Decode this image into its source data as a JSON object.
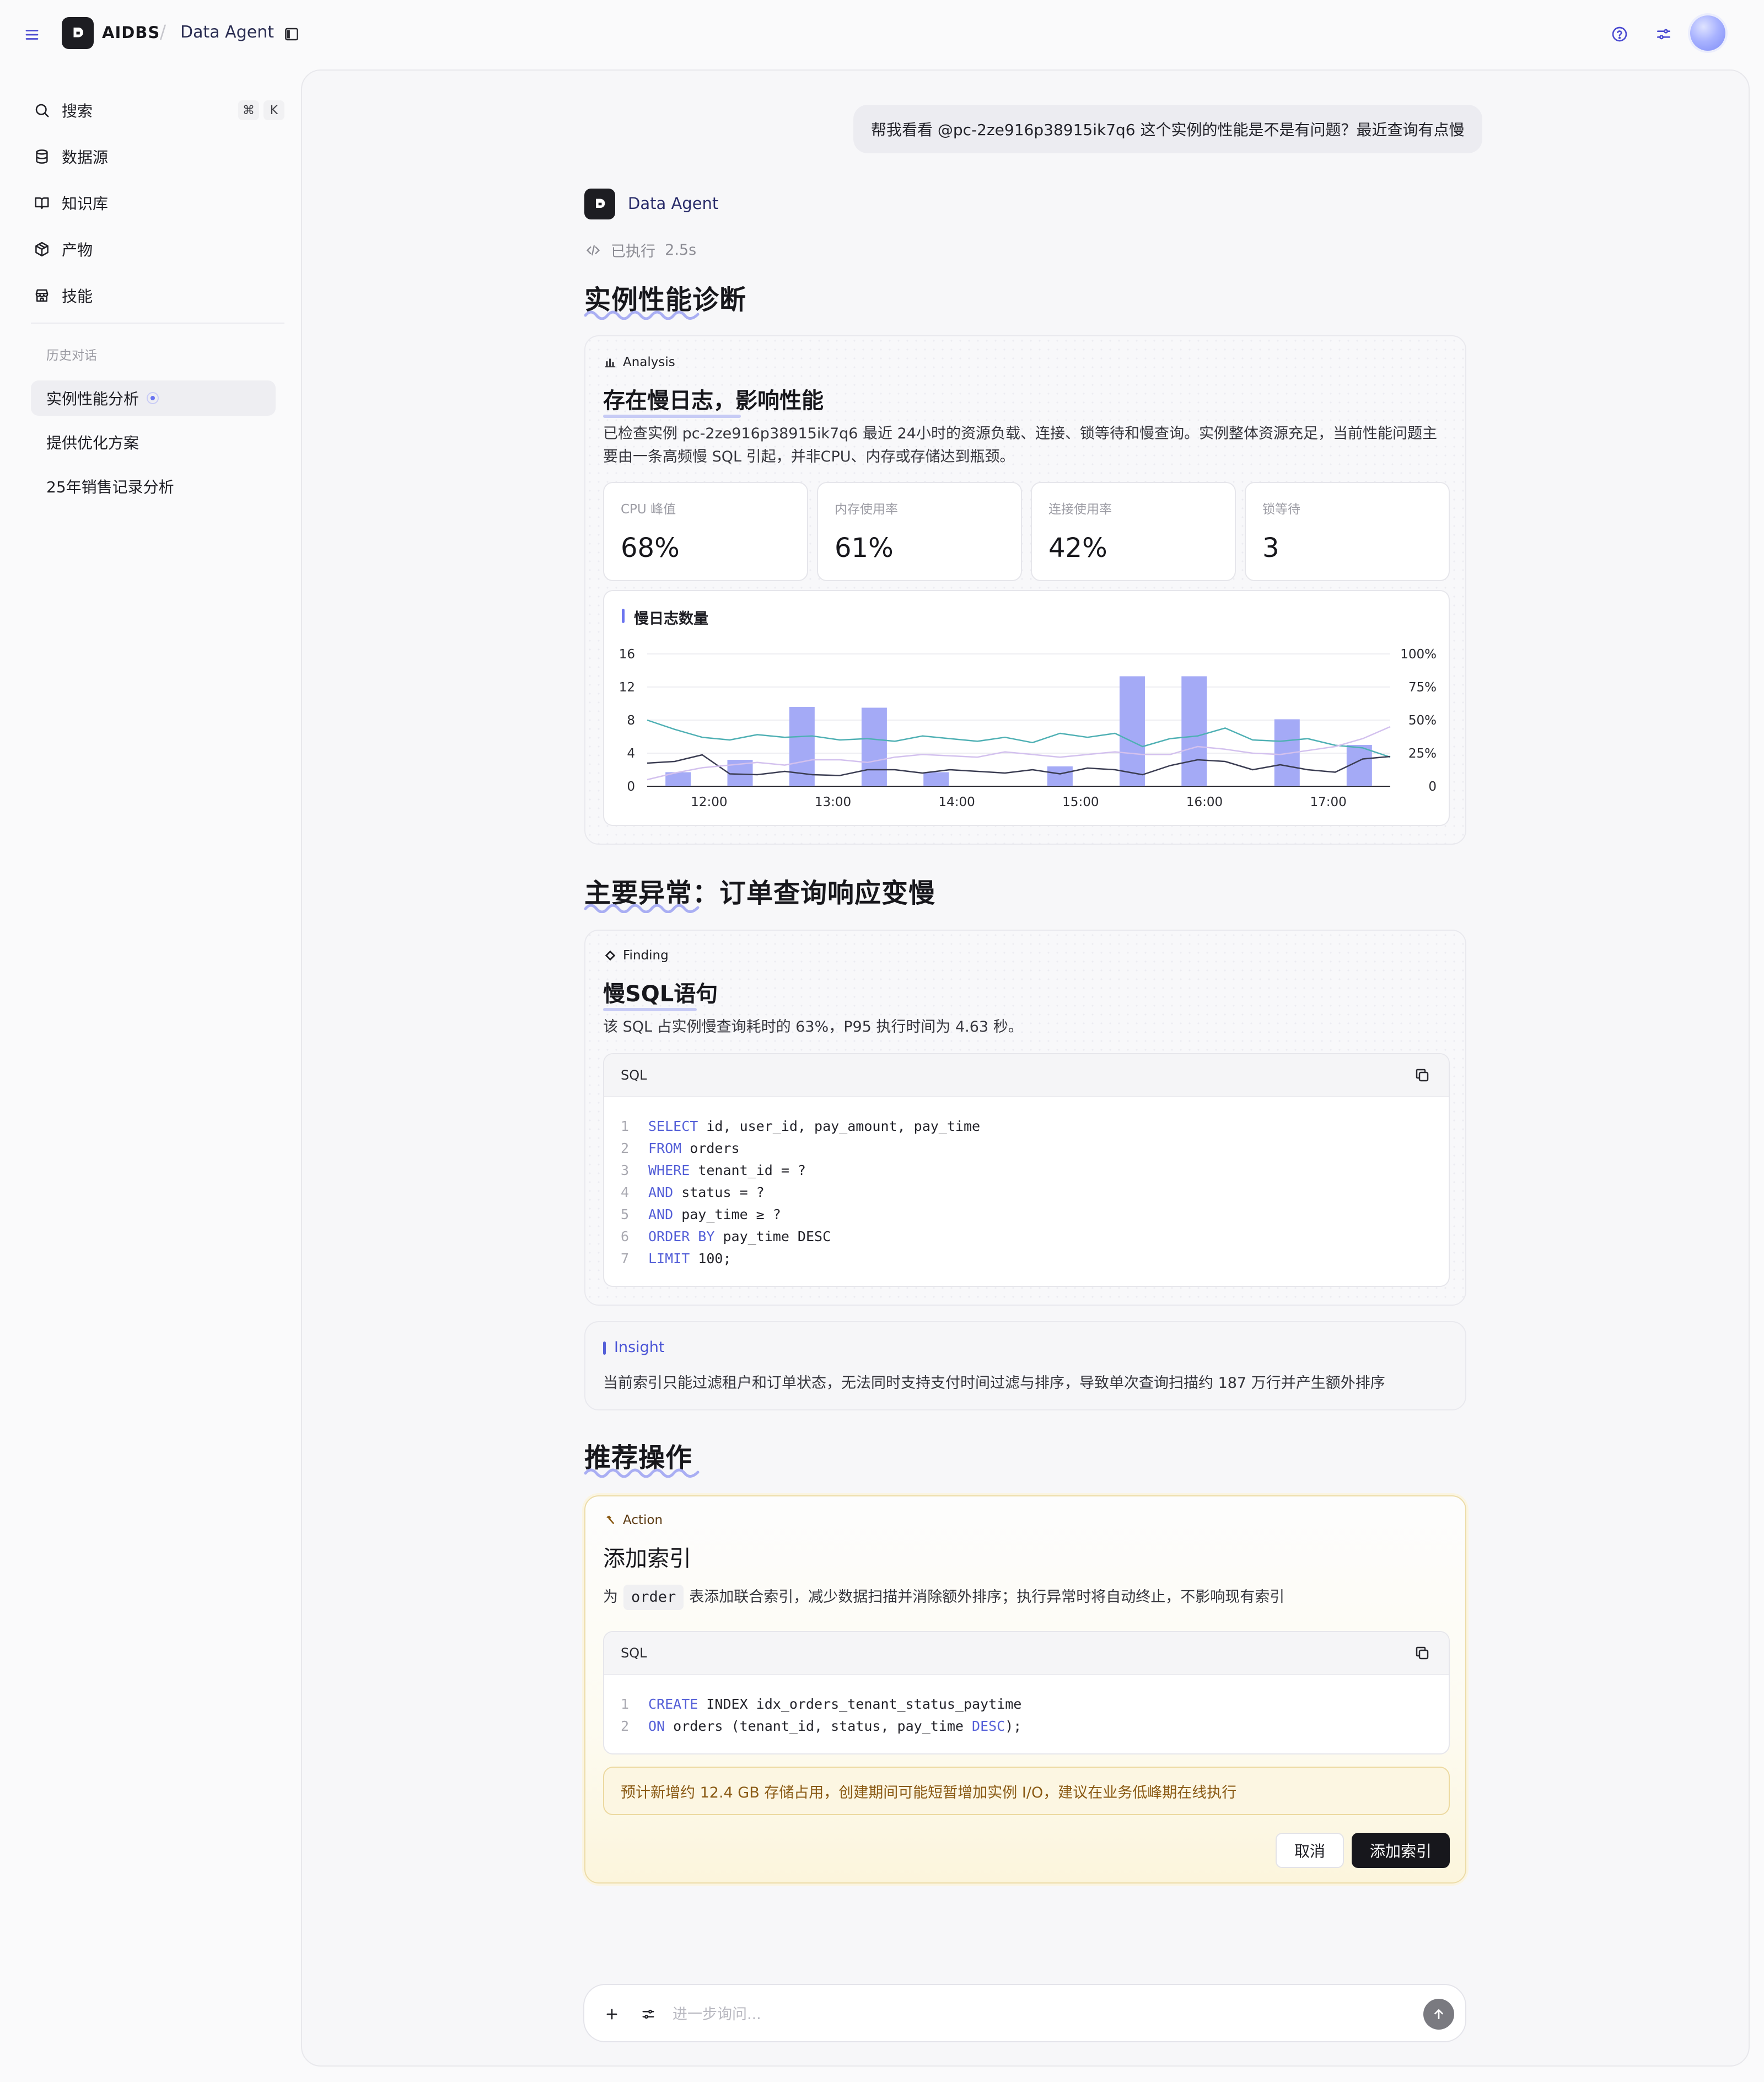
{
  "topbar": {
    "brand": "AIDBS",
    "separator": "/",
    "breadcrumb": "Data Agent"
  },
  "sidebar": {
    "items": [
      {
        "icon": "search-icon",
        "label": "搜索"
      },
      {
        "icon": "database-icon",
        "label": "数据源"
      },
      {
        "icon": "book-icon",
        "label": "知识库"
      },
      {
        "icon": "package-icon",
        "label": "产物"
      },
      {
        "icon": "store-icon",
        "label": "技能"
      }
    ],
    "shortcut": [
      "⌘",
      "K"
    ],
    "history_header": "历史对话",
    "history": [
      "实例性能分析",
      "提供优化方案",
      "25年销售记录分析"
    ]
  },
  "chat": {
    "user_message": "帮我看看 @pc-2ze916p38915ik7q6 这个实例的性能是不是有问题？最近查询有点慢",
    "agent_name": "Data Agent",
    "exec_label": "已执行",
    "exec_time": "2.5s",
    "section1": "实例性能诊断",
    "analysis": {
      "tag": "Analysis",
      "title": "存在慢日志，影响性能",
      "text": "已检查实例 pc-2ze916p38915ik7q6 最近 24小时的资源负载、连接、锁等待和慢查询。实例整体资源充足，当前性能问题主要由一条高频慢 SQL 引起，并非CPU、内存或存储达到瓶颈。",
      "metrics": [
        {
          "label": "CPU 峰值",
          "value": "68%"
        },
        {
          "label": "内存使用率",
          "value": "61%"
        },
        {
          "label": "连接使用率",
          "value": "42%"
        },
        {
          "label": "锁等待",
          "value": "3"
        }
      ]
    },
    "section2": "主要异常：订单查询响应变慢",
    "finding": {
      "tag": "Finding",
      "title": "慢SQL语句",
      "text": "该 SQL 占实例慢查询耗时的 63%，P95 执行时间为 4.63 秒。",
      "code_lang": "SQL",
      "code": [
        [
          "1",
          "SELECT",
          " id, user_id, pay_amount, pay_time"
        ],
        [
          "2",
          "FROM",
          " orders"
        ],
        [
          "3",
          "WHERE",
          " tenant_id = ?"
        ],
        [
          "4",
          "AND",
          " status = ?"
        ],
        [
          "5",
          "AND",
          " pay_time ≥ ?"
        ],
        [
          "6",
          "ORDER BY",
          " pay_time DESC"
        ],
        [
          "7",
          "LIMIT",
          " 100;"
        ]
      ]
    },
    "insight": {
      "tag": "Insight",
      "text": "当前索引只能过滤租户和订单状态，无法同时支持支付时间过滤与排序，导致单次查询扫描约 187 万行并产生额外排序"
    },
    "section3": "推荐操作",
    "action": {
      "tag": "Action",
      "title": "添加索引",
      "text_pre": "为",
      "code_inline": "order",
      "text_post": "表添加联合索引，减少数据扫描并消除额外排序；执行异常时将自动终止，不影响现有索引",
      "code_lang": "SQL",
      "code": [
        [
          "1",
          "CREATE",
          " INDEX idx_orders_tenant_status_paytime",
          ""
        ],
        [
          "2",
          "ON",
          " orders (tenant_id, status, pay_time ",
          "DESC",
          ");"
        ]
      ],
      "warning": "预计新增约 12.4 GB 存储占用，创建期间可能短暂增加实例 I/O，建议在业务低峰期在线执行",
      "cancel": "取消",
      "confirm": "添加索引"
    },
    "composer": {
      "placeholder": "进一步询问..."
    }
  },
  "chart_data": {
    "type": "bar",
    "title": "慢日志数量",
    "x_ticks": [
      "12:00",
      "13:00",
      "14:00",
      "15:00",
      "16:00",
      "17:00"
    ],
    "bars": [
      {
        "x": "11:45",
        "value": 1.7
      },
      {
        "x": "12:15",
        "value": 3.2
      },
      {
        "x": "12:45",
        "value": 9.6
      },
      {
        "x": "13:20",
        "value": 9.5
      },
      {
        "x": "13:50",
        "value": 1.7
      },
      {
        "x": "14:50",
        "value": 2.4
      },
      {
        "x": "15:25",
        "value": 13.3
      },
      {
        "x": "15:55",
        "value": 13.3
      },
      {
        "x": "16:40",
        "value": 8.1
      },
      {
        "x": "17:15",
        "value": 5.0
      }
    ],
    "y_left": {
      "ticks": [
        0,
        4,
        8,
        12,
        16
      ],
      "range": [
        0,
        16
      ]
    },
    "y_right": {
      "ticks": [
        "0",
        "25%",
        "50%",
        "75%",
        "100%"
      ],
      "range": [
        0,
        100
      ]
    },
    "lines": [
      {
        "color": "#4fb0b4",
        "axis": "right",
        "values": [
          50,
          43,
          37,
          35,
          39,
          37,
          38,
          35,
          36,
          34,
          38,
          36,
          34,
          37,
          33,
          40,
          37,
          40,
          30,
          36,
          38,
          44,
          35,
          34,
          36,
          31,
          29,
          22
        ]
      },
      {
        "color": "#3b3d52",
        "axis": "left",
        "values": [
          2.8,
          3.0,
          3.8,
          1.5,
          1.4,
          1.8,
          1.4,
          1.3,
          2.0,
          2.0,
          1.6,
          2.0,
          1.8,
          1.6,
          2.0,
          1.5,
          2.2,
          2.0,
          1.4,
          2.5,
          3.2,
          3.0,
          2.0,
          2.6,
          2.0,
          1.7,
          3.3,
          3.6
        ]
      },
      {
        "color": "#d3c1ee",
        "axis": "right",
        "values": [
          5,
          10,
          14,
          16,
          18,
          16,
          20,
          20,
          18,
          22,
          24,
          23,
          22,
          26,
          24,
          22,
          24,
          26,
          24,
          24,
          30,
          28,
          25,
          24,
          27,
          30,
          36,
          45
        ]
      }
    ],
    "colors": {
      "bar": "#a4aaf6",
      "grid": "#e9e9ee"
    }
  }
}
